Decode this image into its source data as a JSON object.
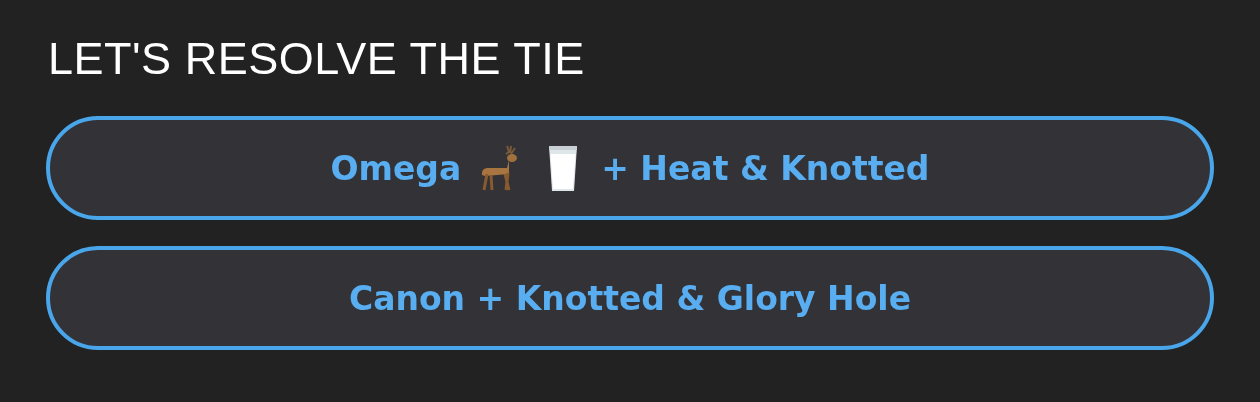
{
  "title": "LET'S RESOLVE THE TIE",
  "options": [
    {
      "segments": [
        {
          "kind": "text",
          "text": "Omega"
        },
        {
          "kind": "icon"
        },
        {
          "kind": "icon"
        },
        {
          "kind": "text",
          "text": "+ Heat & Knotted"
        }
      ]
    },
    {
      "segments": [
        {
          "kind": "text",
          "text": "Canon + Knotted & Glory Hole"
        }
      ]
    }
  ]
}
